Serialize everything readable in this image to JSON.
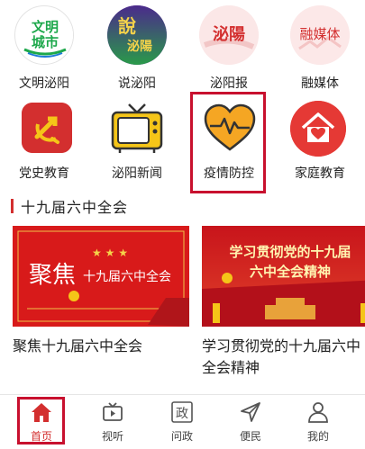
{
  "grid": {
    "row1": [
      {
        "label": "文明泌阳",
        "icon": "wenming-biyang-logo",
        "logo_text": "文明\n城市"
      },
      {
        "label": "说泌阳",
        "icon": "shuo-biyang-logo",
        "logo_text": "说泌陽"
      },
      {
        "label": "泌阳报",
        "icon": "biyang-newspaper-logo",
        "logo_text": "泌陽"
      },
      {
        "label": "融媒体",
        "icon": "rongmeiti-logo",
        "logo_text": "融媒体"
      }
    ],
    "row2": [
      {
        "label": "党史教育",
        "icon": "party-emblem-icon"
      },
      {
        "label": "泌阳新闻",
        "icon": "tv-icon"
      },
      {
        "label": "疫情防控",
        "icon": "heart-pulse-icon"
      },
      {
        "label": "家庭教育",
        "icon": "home-heart-icon"
      }
    ]
  },
  "section": {
    "title": "十九届六中全会"
  },
  "cards": [
    {
      "title": "聚焦十九届六中全会",
      "banner_big": "聚焦",
      "banner_small": "十九届六中全会"
    },
    {
      "title": "学习贯彻党的十九届六中全会精神",
      "banner_line1": "学习贯彻党的十九届",
      "banner_line2": "六中全会精神"
    }
  ],
  "nav": [
    {
      "label": "首页",
      "icon": "home-icon",
      "active": true
    },
    {
      "label": "视听",
      "icon": "video-icon",
      "active": false
    },
    {
      "label": "问政",
      "icon": "politics-icon",
      "icon_char": "政",
      "active": false
    },
    {
      "label": "便民",
      "icon": "send-arrow-icon",
      "active": false
    },
    {
      "label": "我的",
      "icon": "user-icon",
      "active": false
    }
  ],
  "colors": {
    "accent": "#d32f2f",
    "highlight": "#c8102e",
    "banner_red": "#d81a1a",
    "heart_orange": "#f5a623"
  }
}
